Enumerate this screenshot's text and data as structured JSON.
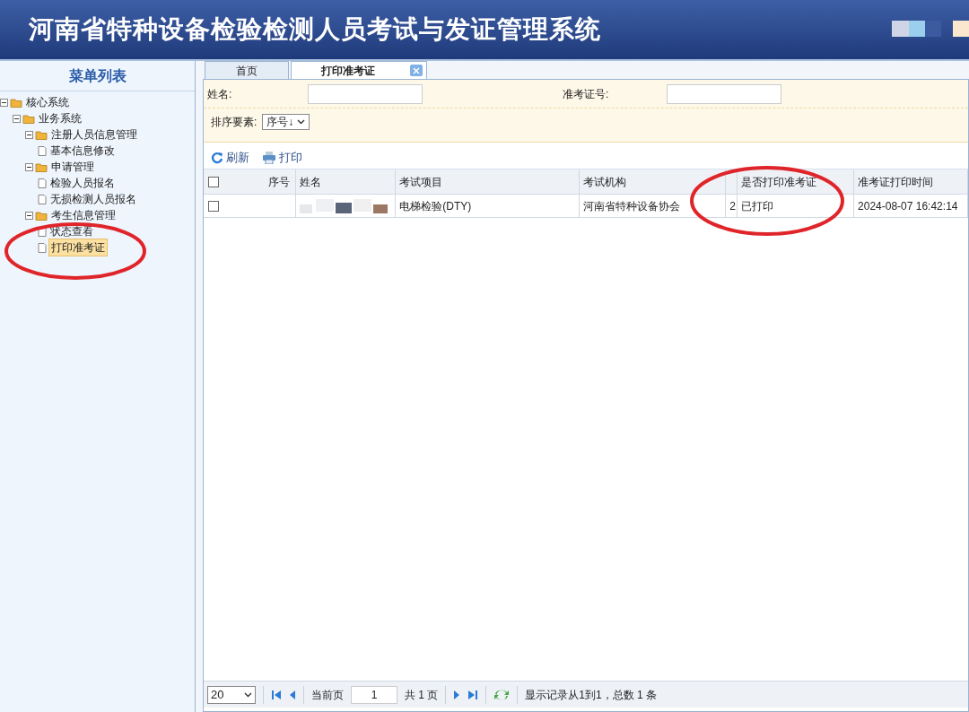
{
  "header": {
    "title": "河南省特种设备检验检测人员考试与发证管理系统"
  },
  "sidebar": {
    "title": "菜单列表",
    "tree": [
      {
        "label": "核心系统",
        "expanded": true,
        "children": [
          {
            "label": "业务系统",
            "expanded": true,
            "children": [
              {
                "label": "注册人员信息管理",
                "expanded": true,
                "children": [
                  {
                    "label": "基本信息修改",
                    "selected": false
                  }
                ]
              },
              {
                "label": "申请管理",
                "expanded": true,
                "children": [
                  {
                    "label": "检验人员报名",
                    "selected": false
                  },
                  {
                    "label": "无损检测人员报名",
                    "selected": false
                  }
                ]
              },
              {
                "label": "考生信息管理",
                "expanded": true,
                "children": [
                  {
                    "label": "状态查看",
                    "selected": false
                  },
                  {
                    "label": "打印准考证",
                    "selected": true
                  }
                ]
              }
            ]
          }
        ]
      }
    ]
  },
  "tabs": [
    {
      "label": "首页",
      "selected": false,
      "closable": false
    },
    {
      "label": "打印准考证",
      "selected": true,
      "closable": true
    }
  ],
  "filters": {
    "name_label": "姓名:",
    "ticket_label": "准考证号:",
    "sort_label": "排序要素:",
    "sort_value": "序号↓"
  },
  "toolbar": [
    {
      "kind": "refresh",
      "label": "刷新"
    },
    {
      "kind": "print",
      "label": "打印"
    }
  ],
  "table": {
    "all_checked": false,
    "columns": [
      "序号",
      "姓名",
      "考试项目",
      "考试机构",
      "",
      "是否打印准考证",
      "准考证打印时间"
    ],
    "rows": [
      {
        "checked": false,
        "cells": [
          "",
          "",
          "电梯检验(DTY)",
          "河南省特种设备协会",
          "2",
          "已打印",
          "2024-08-07 16:42:14"
        ]
      }
    ]
  },
  "pager": {
    "page_size": "20",
    "current_label": "当前页",
    "current_page": "1",
    "total_pages": "共 1 页",
    "summary": "显示记录从1到1，总数 1 条"
  }
}
